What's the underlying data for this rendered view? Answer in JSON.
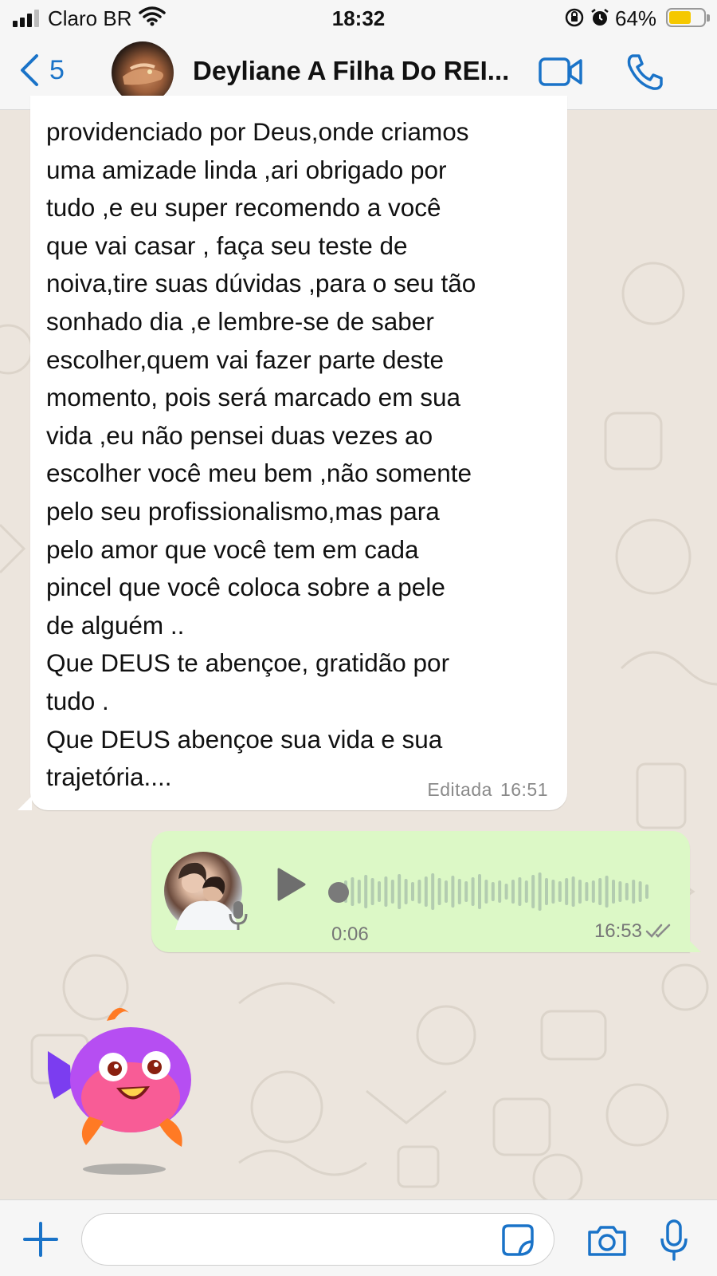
{
  "status_bar": {
    "carrier": "Claro BR",
    "time": "18:32",
    "battery_percent": "64%",
    "battery_level": 0.64,
    "icons": [
      "signal-icon",
      "wifi-icon",
      "orientation-lock-icon",
      "alarm-icon",
      "battery-icon"
    ]
  },
  "header": {
    "back_count": "5",
    "contact_name": "Deyliane A Filha Do REI...",
    "icons": [
      "back-chevron-icon",
      "video-call-icon",
      "phone-call-icon"
    ]
  },
  "messages": {
    "incoming": {
      "lines": [
        "providenciado por Deus,onde criamos",
        "uma amizade linda ,ari obrigado por",
        "tudo ,e eu super recomendo a você",
        "que vai casar , faça seu teste de",
        "noiva,tire suas dúvidas ,para o seu tão",
        "sonhado dia ,e lembre-se de saber",
        "escolher,quem vai fazer parte deste",
        "momento, pois será marcado em sua",
        "vida ,eu não pensei duas vezes ao",
        "escolher você meu bem ,não somente",
        "pelo seu profissionalismo,mas para",
        "pelo amor que você tem em cada",
        "pincel que você coloca sobre a pele",
        "de alguém ..",
        "Que DEUS te abençoe, gratidão por",
        "tudo .",
        "Que DEUS abençoe sua vida e sua",
        "trajetória...."
      ],
      "edited_label": "Editada",
      "time": "16:51"
    },
    "voice": {
      "duration": "0:06",
      "time": "16:53",
      "status": "read",
      "progress": 0
    },
    "sticker": {
      "description_icon": "fish-sticker"
    }
  },
  "composer": {
    "input_value": "",
    "input_placeholder": "",
    "icons": [
      "plus-icon",
      "sticker-icon",
      "camera-icon",
      "microphone-icon"
    ]
  },
  "colors": {
    "accent": "#1a73c8",
    "incoming_bubble": "#ffffff",
    "outgoing_bubble": "#dcf8c6",
    "chat_background": "#ece5dd",
    "battery": "#f5c800"
  }
}
